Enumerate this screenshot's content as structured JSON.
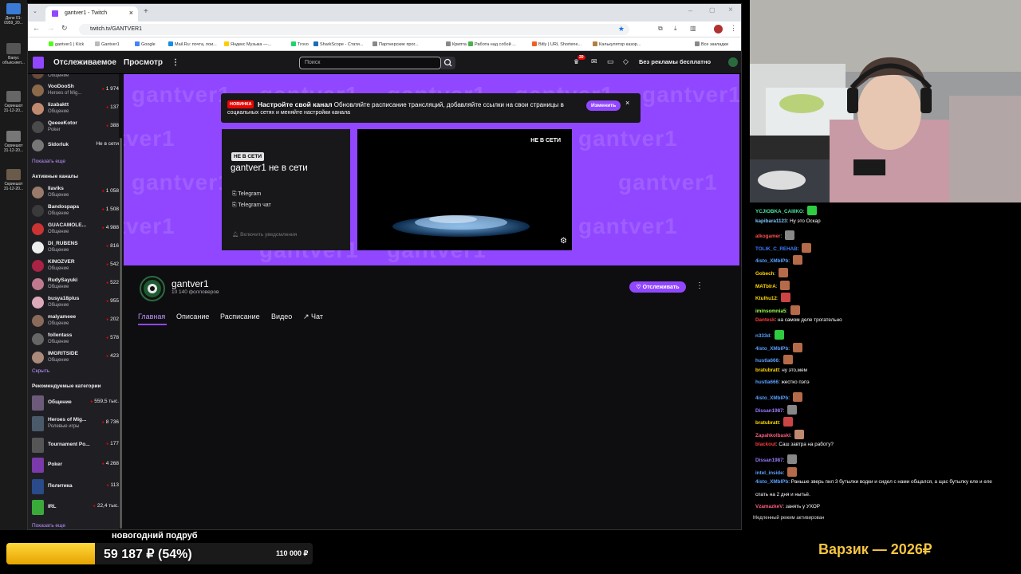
{
  "desktop": {
    "icons": [
      {
        "label": "Дело 01-0959_20..."
      },
      {
        "label": "Вапус объясняет..."
      },
      {
        "label": "Скриншот 31-12-20..."
      },
      {
        "label": "Скриншот 31-12-20..."
      },
      {
        "label": "Скриншот 31-12-20..."
      },
      {
        "label": "Скриншот 31-12-20..."
      }
    ]
  },
  "browser": {
    "tab_title": "gantver1 - Twitch",
    "url": "twitch.tv/GANTVER1",
    "bookmarks": [
      {
        "label": "gantver1 | Kick",
        "color": "#53fc18"
      },
      {
        "label": "Gantver1",
        "color": "#bbbbbb"
      },
      {
        "label": "Google",
        "color": "#4285f4"
      },
      {
        "label": "Mail.Ru: почта, пои...",
        "color": "#168de2"
      },
      {
        "label": "Яндекс Музыка —...",
        "color": "#ffcc00"
      },
      {
        "label": "Trovo",
        "color": "#19d66b"
      },
      {
        "label": "SharkScope - Стати...",
        "color": "#1e6bb8"
      },
      {
        "label": "Партнерские прог...",
        "color": "#888888"
      },
      {
        "label": "Крипта",
        "color": "#888888"
      },
      {
        "label": "Работа над собой ...",
        "color": "#4caf50"
      },
      {
        "label": "Bitly | URL Shortene...",
        "color": "#ee6123"
      },
      {
        "label": "Калькулятор казор...",
        "color": "#b08040"
      },
      {
        "label": "Все закладки",
        "color": "#888888"
      }
    ]
  },
  "twitch": {
    "nav": {
      "following": "Отслеживаемое",
      "browse": "Просмотр",
      "more": "⋮",
      "search_placeholder": "Поиск",
      "notifications_count": "20",
      "no_ads": "Без рекламы бесплатно"
    },
    "sidebar": {
      "followed": [
        {
          "name": "",
          "sub": "Общение",
          "count": "",
          "color": "#6a4a3a"
        },
        {
          "name": "VooDooSh",
          "sub": "Heroes of Mig...",
          "count": "1 974",
          "color": "#8a6a4a"
        },
        {
          "name": "lizabaktt",
          "sub": "Общение",
          "count": "137",
          "color": "#c08a70"
        },
        {
          "name": "QeeeeKotor",
          "sub": "Poker",
          "count": "388",
          "color": "#4a4a4a"
        },
        {
          "name": "Sidorluk",
          "sub": "",
          "count": "Не в сети",
          "color": "#777777"
        }
      ],
      "show_more": "Показать еще",
      "active_header": "Активные каналы",
      "active": [
        {
          "name": "Ilaviks",
          "sub": "Общение",
          "count": "1 058",
          "color": "#9a7a6a"
        },
        {
          "name": "Bandospapa",
          "sub": "Общение",
          "count": "1 508",
          "color": "#3a3a3a"
        },
        {
          "name": "GUACAMOLE...",
          "sub": "Общение",
          "count": "4 988",
          "color": "#cc3333"
        },
        {
          "name": "DI_RUBENS",
          "sub": "Общение",
          "count": "816",
          "color": "#eeeeee"
        },
        {
          "name": "KINOZVER",
          "sub": "Общение",
          "count": "542",
          "color": "#aa2244"
        },
        {
          "name": "RudySayuki",
          "sub": "Общение",
          "count": "522",
          "color": "#c07a90"
        },
        {
          "name": "busya18plus",
          "sub": "Общение",
          "count": "955",
          "color": "#ddaabb"
        },
        {
          "name": "malyameee",
          "sub": "Общение",
          "count": "202",
          "color": "#8a6a5a"
        },
        {
          "name": "follentass",
          "sub": "Общение",
          "count": "578",
          "color": "#666666"
        },
        {
          "name": "IMGRITSIDE",
          "sub": "Общение",
          "count": "423",
          "color": "#aa8a7a"
        }
      ],
      "hide": "Скрыть",
      "recommended_header": "Рекомендуемые категории",
      "categories": [
        {
          "name": "Общение",
          "sub": "",
          "count": "559,5 тыс.",
          "color": "#6b5a7a"
        },
        {
          "name": "Heroes of Mig...",
          "sub": "Ролевые игры",
          "count": "8 736",
          "color": "#4a5a6a"
        },
        {
          "name": "Tournament Po...",
          "sub": "",
          "count": "177",
          "color": "#555555"
        },
        {
          "name": "Poker",
          "sub": "",
          "count": "4 268",
          "color": "#7a3aaa"
        },
        {
          "name": "Политика",
          "sub": "",
          "count": "113",
          "color": "#2a4a8a"
        },
        {
          "name": "IRL",
          "sub": "",
          "count": "22,4 тыс.",
          "color": "#3aaa3a"
        }
      ],
      "show_more_2": "Показать еще"
    },
    "banner_watermark": "gantver1",
    "notice": {
      "badge": "НОВИНКА",
      "title": "Настройте свой канал",
      "text1": "Обновляйте расписание трансляций, добавляйте ссылки на свои страницы в",
      "text2": "социальных сетях и меняйте настройки канала",
      "button": "Изменить",
      "close": "×"
    },
    "offline_card": {
      "label": "НЕ В СЕТИ",
      "title": "gantver1 не в сети",
      "link1": "Telegram",
      "link2": "Telegram чат",
      "notify": "Включить уведомления"
    },
    "video": {
      "status": "НЕ В СЕТИ"
    },
    "channel": {
      "name": "gantver1",
      "followers": "10 140 фолловеров",
      "follow_button": "Отслеживать",
      "tabs": [
        "Главная",
        "Описание",
        "Расписание",
        "Видео",
        "Чат"
      ]
    }
  },
  "chat": {
    "messages": [
      {
        "user": "YCJIOBKA_CAIIIKO",
        "color": "#4be3a0",
        "text": "",
        "emote": "#2ecc40"
      },
      {
        "user": "kapibara1123",
        "color": "#7ec8ff",
        "text": "Ну это Оскар",
        "emote": ""
      },
      {
        "user": "alkogamer",
        "color": "#ff4f4f",
        "text": "",
        "emote": "#888888"
      },
      {
        "user": "TOLIK_C_REHAB",
        "color": "#3d7bff",
        "text": "",
        "emote": "#b56a4a"
      },
      {
        "user": "4isto_XMbIPb",
        "color": "#5aa0ff",
        "text": "",
        "emote": "#b56a4a"
      },
      {
        "user": "Gobech",
        "color": "#ffd700",
        "text": "",
        "emote": "#b56a4a"
      },
      {
        "user": "MATbIrA",
        "color": "#ffd700",
        "text": "",
        "emote": "#b56a4a"
      },
      {
        "user": "Ktulhu12",
        "color": "#ffd700",
        "text": "",
        "emote": "#cc4444"
      },
      {
        "user": "iminsomnia5",
        "color": "#9cff4f",
        "text": "",
        "emote": "#b56a4a"
      },
      {
        "user": "Dantesk",
        "color": "#ff3d3d",
        "text": "на самом деле трогательно",
        "emote": ""
      },
      {
        "user": "n333d",
        "color": "#5aa0ff",
        "text": "",
        "emote": "#2ecc40"
      },
      {
        "user": "4isto_XMbIPb",
        "color": "#5aa0ff",
        "text": "",
        "emote": "#b56a4a"
      },
      {
        "user": "hustla666",
        "color": "#5aa0ff",
        "text": "",
        "emote": "#b56a4a"
      },
      {
        "user": "bratubratt",
        "color": "#ffd700",
        "text": "ну это,мем",
        "emote": ""
      },
      {
        "user": "hustla666",
        "color": "#5aa0ff",
        "text": "жестко пэпэ",
        "emote": ""
      },
      {
        "user": "4isto_XMbIPb",
        "color": "#5aa0ff",
        "text": "",
        "emote": "#b56a4a"
      },
      {
        "user": "Dissan1987",
        "color": "#9b7bff",
        "text": "",
        "emote": "#888888"
      },
      {
        "user": "bratubratt",
        "color": "#ffd700",
        "text": "",
        "emote": "#cc4444"
      },
      {
        "user": "Zapahkolbaski",
        "color": "#ff5f7f",
        "text": "",
        "emote": "#c08a70"
      },
      {
        "user": "blackout",
        "color": "#ff3d3d",
        "text": "Саш завтра на работу?",
        "emote": ""
      },
      {
        "user": "Dissan1987",
        "color": "#9b7bff",
        "text": "",
        "emote": "#888888"
      },
      {
        "user": "intel_inside",
        "color": "#5aa0ff",
        "text": "",
        "emote": "#b56a4a"
      },
      {
        "user": "4isto_XMbIPb",
        "color": "#5aa0ff",
        "text": "Раньше зверь пил 3 бутылки водки и сидел с нами общался, а щас бутылку еле и еле",
        "emote": ""
      },
      {
        "user": "",
        "color": "#ffffff",
        "text": "спать на 2 дня и нытьё.",
        "emote": ""
      },
      {
        "user": "VzamazkeV",
        "color": "#ff5f7f",
        "text": "занять у УХОР",
        "emote": ""
      }
    ],
    "slow_mode": "Медленный режим активирован"
  },
  "overlay": {
    "goal_title": "новогодний подруб",
    "goal_value": "59 187 ₽ (54%)",
    "goal_progress": 0.54,
    "goal_target": "110 000 ₽",
    "varzik": "Варзик — 2026₽"
  }
}
